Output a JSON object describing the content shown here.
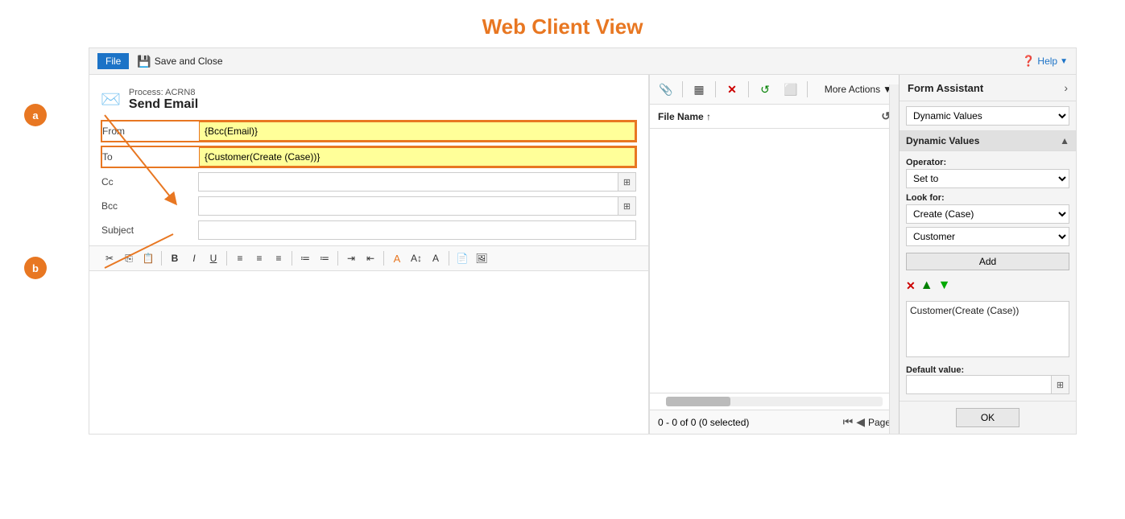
{
  "page": {
    "title": "Web Client View"
  },
  "toolbar": {
    "file_label": "File",
    "save_close_label": "Save and Close",
    "help_label": "Help"
  },
  "process": {
    "label": "Process: ACRN8",
    "name": "Send Email"
  },
  "fields": {
    "from_label": "From",
    "from_value": "{Bcc(Email)}",
    "to_label": "To",
    "to_value": "{Customer(Create (Case))}",
    "cc_label": "Cc",
    "bcc_label": "Bcc",
    "subject_label": "Subject"
  },
  "attachment": {
    "more_actions": "More Actions",
    "file_name_header": "File Name",
    "sort_indicator": "↑",
    "stats": "0 - 0 of 0 (0 selected)",
    "page_label": "Page"
  },
  "form_assistant": {
    "title": "Form Assistant",
    "dynamic_values_dropdown": "Dynamic Values",
    "section_label": "Dynamic Values",
    "operator_label": "Operator:",
    "operator_value": "Set to",
    "look_for_label": "Look for:",
    "look_for_value1": "Create (Case)",
    "look_for_value2": "Customer",
    "add_label": "Add",
    "value_box_content": "Customer(Create (Case))",
    "default_value_label": "Default value:",
    "ok_label": "OK"
  },
  "annotations": {
    "a": "a",
    "b": "b"
  }
}
